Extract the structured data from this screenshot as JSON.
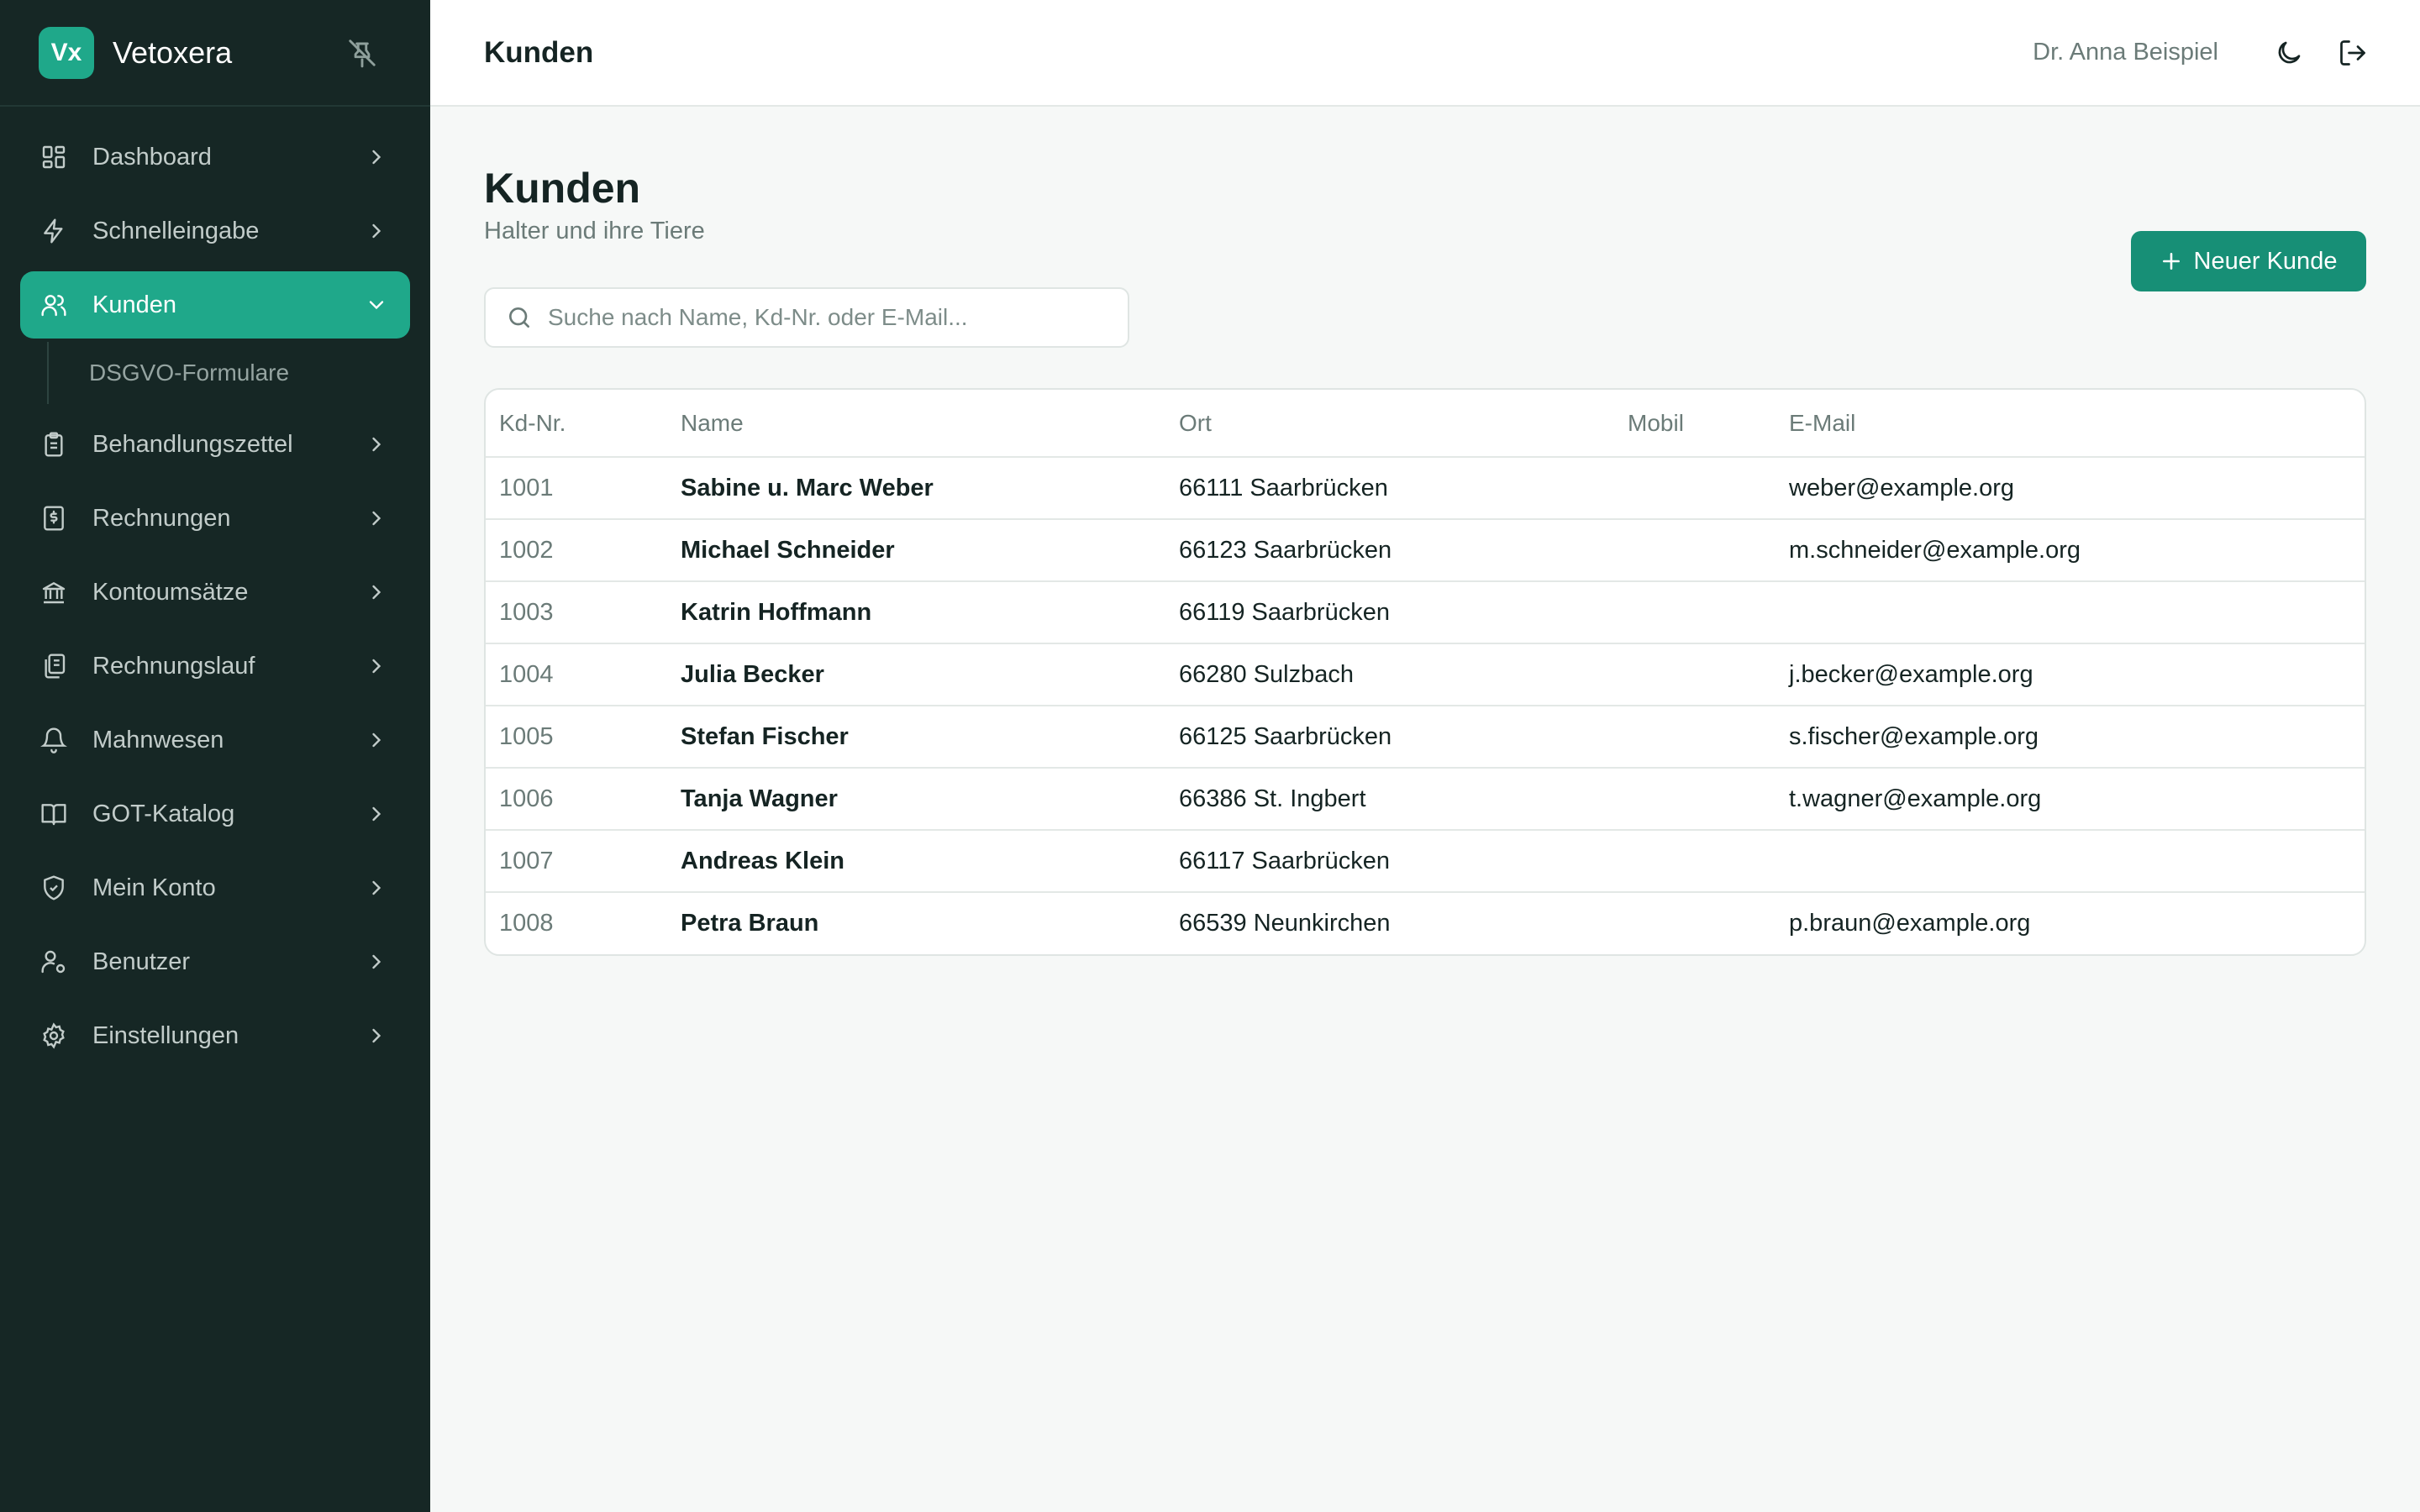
{
  "brand": {
    "logo_text": "Vx",
    "name": "Vetoxera"
  },
  "sidebar": {
    "items": [
      {
        "label": "Dashboard",
        "icon": "dashboard-icon"
      },
      {
        "label": "Schnelleingabe",
        "icon": "lightning-icon"
      },
      {
        "label": "Kunden",
        "icon": "users-icon",
        "active": true,
        "expanded": true
      },
      {
        "label": "Behandlungszettel",
        "icon": "clipboard-icon"
      },
      {
        "label": "Rechnungen",
        "icon": "invoice-icon"
      },
      {
        "label": "Kontoumsätze",
        "icon": "bank-icon"
      },
      {
        "label": "Rechnungslauf",
        "icon": "documents-icon"
      },
      {
        "label": "Mahnwesen",
        "icon": "bell-icon"
      },
      {
        "label": "GOT-Katalog",
        "icon": "book-icon"
      },
      {
        "label": "Mein Konto",
        "icon": "shield-icon"
      },
      {
        "label": "Benutzer",
        "icon": "user-cog-icon"
      },
      {
        "label": "Einstellungen",
        "icon": "gear-icon"
      }
    ],
    "subitems": [
      {
        "label": "DSGVO-Formulare"
      }
    ]
  },
  "header": {
    "title": "Kunden",
    "user": "Dr. Anna Beispiel"
  },
  "page": {
    "title": "Kunden",
    "subtitle": "Halter und ihre Tiere",
    "new_button": "Neuer Kunde",
    "search_placeholder": "Suche nach Name, Kd-Nr. oder E-Mail..."
  },
  "table": {
    "columns": [
      "Kd-Nr.",
      "Name",
      "Ort",
      "Mobil",
      "E-Mail"
    ],
    "rows": [
      {
        "kdnr": "1001",
        "name": "Sabine u. Marc Weber",
        "ort": "66111 Saarbrücken",
        "mobil": "",
        "email": "weber@example.org"
      },
      {
        "kdnr": "1002",
        "name": "Michael Schneider",
        "ort": "66123 Saarbrücken",
        "mobil": "",
        "email": "m.schneider@example.org"
      },
      {
        "kdnr": "1003",
        "name": "Katrin Hoffmann",
        "ort": "66119 Saarbrücken",
        "mobil": "",
        "email": ""
      },
      {
        "kdnr": "1004",
        "name": "Julia Becker",
        "ort": "66280 Sulzbach",
        "mobil": "",
        "email": "j.becker@example.org"
      },
      {
        "kdnr": "1005",
        "name": "Stefan Fischer",
        "ort": "66125 Saarbrücken",
        "mobil": "",
        "email": "s.fischer@example.org"
      },
      {
        "kdnr": "1006",
        "name": "Tanja Wagner",
        "ort": "66386 St. Ingbert",
        "mobil": "",
        "email": "t.wagner@example.org"
      },
      {
        "kdnr": "1007",
        "name": "Andreas Klein",
        "ort": "66117 Saarbrücken",
        "mobil": "",
        "email": ""
      },
      {
        "kdnr": "1008",
        "name": "Petra Braun",
        "ort": "66539 Neunkirchen",
        "mobil": "",
        "email": "p.braun@example.org"
      }
    ]
  },
  "colors": {
    "sidebar_bg": "#162725",
    "accent": "#1fa88a",
    "button": "#178f76"
  }
}
